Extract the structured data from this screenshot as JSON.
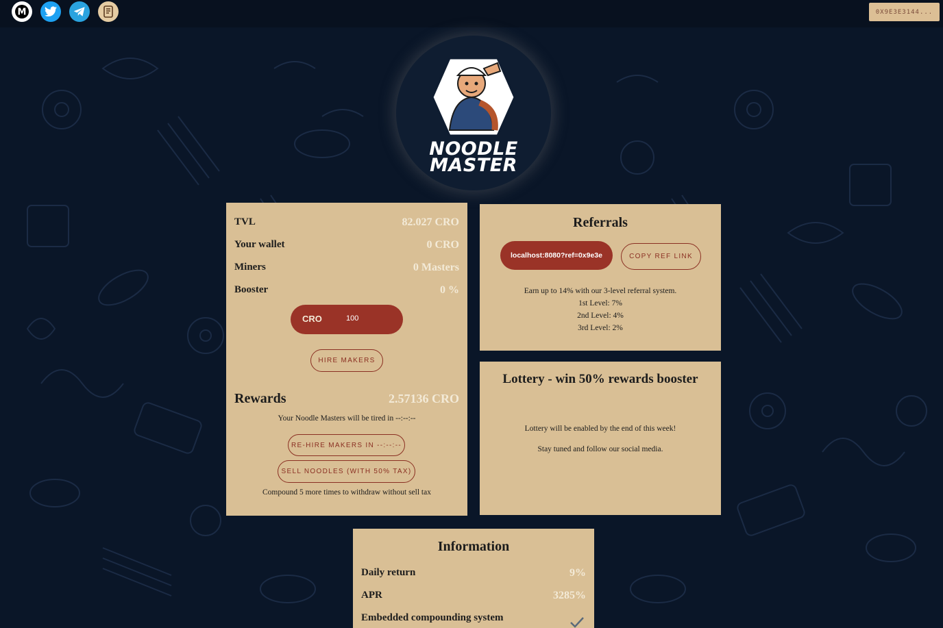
{
  "colors": {
    "background": "#0a1628",
    "panel": "#d9bf95",
    "accent": "#9a3327",
    "value_text": "#f3ead7"
  },
  "header": {
    "socials": [
      {
        "icon": "medium-icon"
      },
      {
        "icon": "twitter-icon"
      },
      {
        "icon": "telegram-icon"
      },
      {
        "icon": "document-icon"
      }
    ],
    "wallet_label": "0X9E3E3144..."
  },
  "logo": {
    "line1": "NOODLE",
    "line2": "MASTER"
  },
  "stats": {
    "tvl_label": "TVL",
    "tvl_value": "82.027 CRO",
    "wallet_label": "Your wallet",
    "wallet_value": "0 CRO",
    "miners_label": "Miners",
    "miners_value": "0 Masters",
    "booster_label": "Booster",
    "booster_value": "0 %",
    "input_currency": "CRO",
    "input_value": "100",
    "hire_label": "HIRE MAKERS",
    "rewards_label": "Rewards",
    "rewards_value": "2.57136 CRO",
    "tired_text": "Your Noodle Masters will be tired in --:--:--",
    "rehire_label": "RE-HIRE MAKERS IN --:--:--",
    "sell_label": "SELL NOODLES (WITH 50% TAX)",
    "compound_text": "Compound 5 more times to withdraw without sell tax"
  },
  "referrals": {
    "title": "Referrals",
    "link": "localhost:8080?ref=0x9e3e",
    "copy_label": "COPY REF LINK",
    "lines": [
      "Earn up to 14% with our 3-level referral system.",
      "1st Level: 7%",
      "2nd Level: 4%",
      "3rd Level: 2%"
    ]
  },
  "lottery": {
    "title": "Lottery - win 50% rewards booster",
    "line1": "Lottery will be enabled by the end of this week!",
    "line2": "Stay tuned and follow our social media."
  },
  "information": {
    "title": "Information",
    "daily_label": "Daily return",
    "daily_value": "9%",
    "apr_label": "APR",
    "apr_value": "3285%",
    "compound_label": "Embedded compounding system"
  }
}
